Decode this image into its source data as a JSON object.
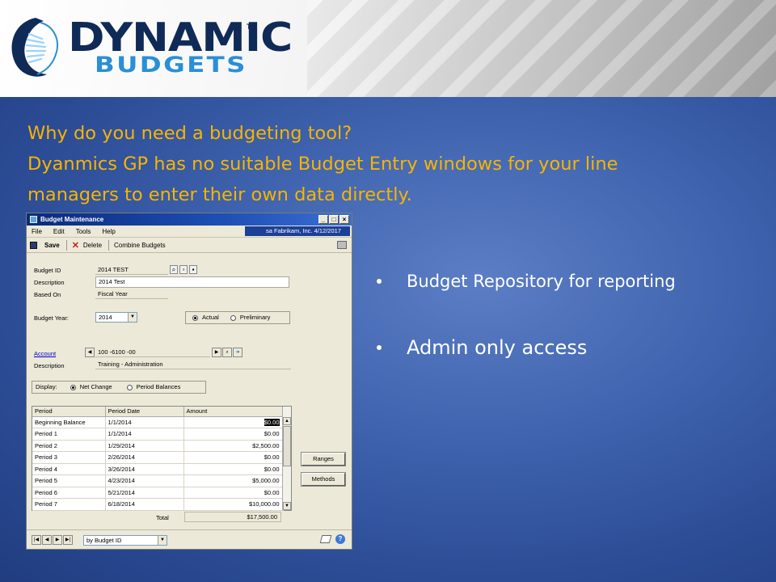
{
  "logo": {
    "word": "DYNAMIC",
    "trademark": "TM",
    "sub": "BUDGETS"
  },
  "headline": {
    "line1": "Why do you need a budgeting tool?",
    "line2": "Dyanmics GP has no suitable Budget Entry windows for your line",
    "line3": "managers to enter their own data directly."
  },
  "bullets": [
    "Budget Repository for reporting",
    "Admin only access"
  ],
  "colors": {
    "headline": "#f7b500",
    "background": "#3f63ae",
    "logo_navy": "#0f2a56",
    "logo_blue": "#2a8fd6"
  },
  "window": {
    "title": "Budget Maintenance",
    "controls": [
      "_",
      "□",
      "×"
    ],
    "menu": [
      "File",
      "Edit",
      "Tools",
      "Help"
    ],
    "company_info": "sa  Fabrikam, Inc.  4/12/2017",
    "toolbar": {
      "save": "Save",
      "delete": "Delete",
      "combine": "Combine Budgets"
    },
    "fields": {
      "budget_id_label": "Budget ID",
      "budget_id": "2014 TEST",
      "description_label": "Description",
      "description": "2014 Test",
      "based_on_label": "Based On",
      "based_on": "Fiscal Year",
      "budget_year_label": "Budget Year:",
      "budget_year": "2014",
      "actual": "Actual",
      "preliminary": "Preliminary",
      "account_label": "Account",
      "account": "100 -6100 -00",
      "acct_description_label": "Description",
      "acct_description": "Training - Administration",
      "display_label": "Display:",
      "net_change": "Net Change",
      "period_balances": "Period Balances"
    },
    "grid": {
      "headers": [
        "Period",
        "Period Date",
        "Amount"
      ],
      "rows": [
        {
          "period": "Beginning Balance",
          "date": "1/1/2014",
          "amount": "$0.00"
        },
        {
          "period": "Period 1",
          "date": "1/1/2014",
          "amount": "$0.00"
        },
        {
          "period": "Period 2",
          "date": "1/29/2014",
          "amount": "$2,500.00"
        },
        {
          "period": "Period 3",
          "date": "2/26/2014",
          "amount": "$0.00"
        },
        {
          "period": "Period 4",
          "date": "3/26/2014",
          "amount": "$0.00"
        },
        {
          "period": "Period 5",
          "date": "4/23/2014",
          "amount": "$5,000.00"
        },
        {
          "period": "Period 6",
          "date": "5/21/2014",
          "amount": "$0.00"
        },
        {
          "period": "Period 7",
          "date": "6/18/2014",
          "amount": "$10,000.00"
        }
      ],
      "total_label": "Total",
      "total": "$17,500.00"
    },
    "buttons": {
      "ranges": "Ranges",
      "methods": "Methods"
    },
    "sort_by": "by Budget ID"
  }
}
